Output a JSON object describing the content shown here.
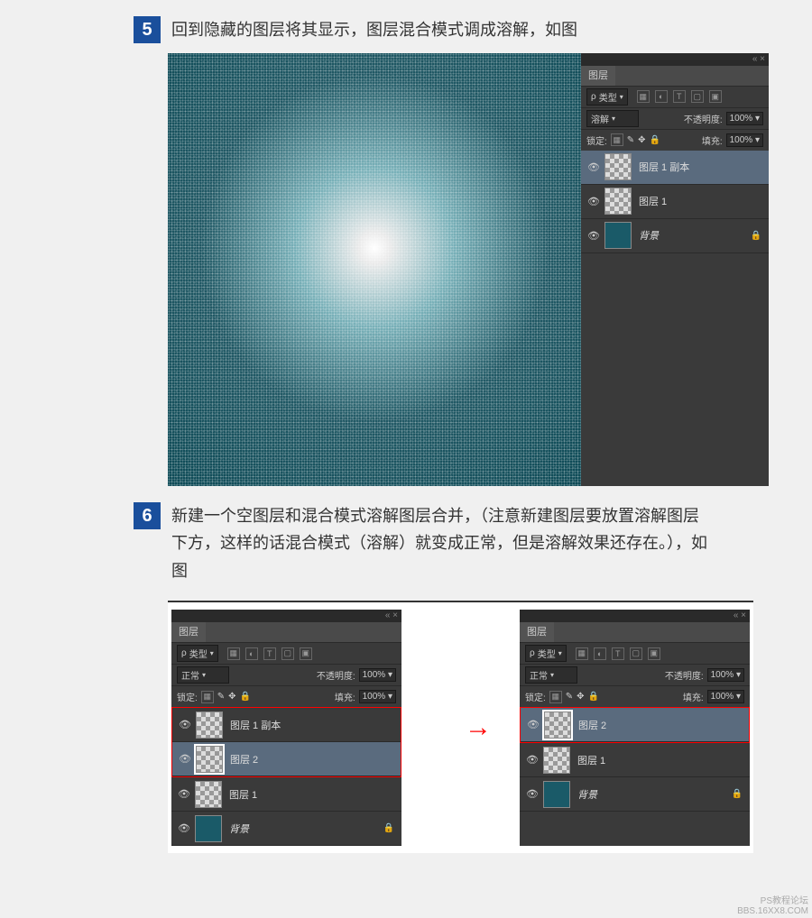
{
  "steps": {
    "5": {
      "number": "5",
      "text": "回到隐藏的图层将其显示，图层混合模式调成溶解，如图"
    },
    "6": {
      "number": "6",
      "text": "新建一个空图层和混合模式溶解图层合并，（注意新建图层要放置溶解图层下方，这样的话混合模式（溶解）就变成正常，但是溶解效果还存在。），如图"
    }
  },
  "panel5": {
    "tab": "图层",
    "type_label": "类型",
    "blend_mode": "溶解",
    "opacity_label": "不透明度:",
    "opacity_val": "100%",
    "lock_label": "锁定:",
    "fill_label": "填充:",
    "fill_val": "100%",
    "filter_t": "T",
    "layers": [
      {
        "name": "图层 1 副本",
        "thumb": "checker",
        "selected": true
      },
      {
        "name": "图层 1",
        "thumb": "checker",
        "selected": false
      },
      {
        "name": "背景",
        "thumb": "teal",
        "selected": false,
        "locked": true
      }
    ]
  },
  "panel6a": {
    "tab": "图层",
    "type_label": "类型",
    "blend_mode": "正常",
    "opacity_label": "不透明度:",
    "opacity_val": "100%",
    "lock_label": "锁定:",
    "fill_label": "填充:",
    "fill_val": "100%",
    "filter_t": "T",
    "layers": [
      {
        "name": "图层 1 副本",
        "thumb": "checker",
        "selected": false,
        "red": true
      },
      {
        "name": "图层 2",
        "thumb": "checker",
        "selected": true,
        "red": true
      },
      {
        "name": "图层 1",
        "thumb": "checker",
        "selected": false
      },
      {
        "name": "背景",
        "thumb": "teal",
        "selected": false,
        "locked": true
      }
    ]
  },
  "panel6b": {
    "tab": "图层",
    "type_label": "类型",
    "blend_mode": "正常",
    "opacity_label": "不透明度:",
    "opacity_val": "100%",
    "lock_label": "锁定:",
    "fill_label": "填充:",
    "fill_val": "100%",
    "filter_t": "T",
    "layers": [
      {
        "name": "图层 2",
        "thumb": "checker",
        "selected": true,
        "red": true
      },
      {
        "name": "图层 1",
        "thumb": "checker",
        "selected": false
      },
      {
        "name": "背景",
        "thumb": "teal",
        "selected": false,
        "locked": true
      }
    ]
  },
  "watermark": {
    "line1": "PS教程论坛",
    "line2": "BBS.16XX8.COM"
  },
  "arrow": "→"
}
